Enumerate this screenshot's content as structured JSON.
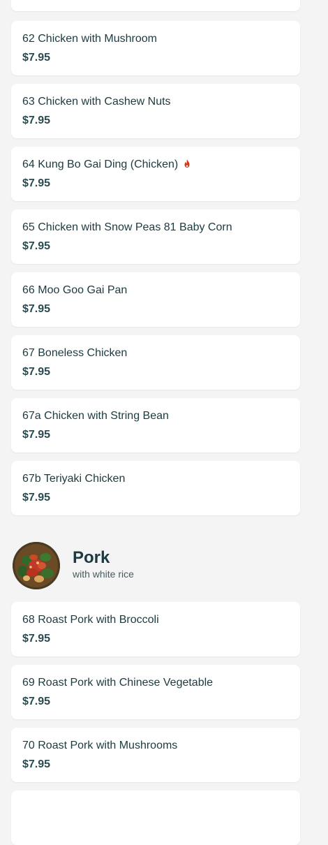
{
  "items_above": [
    {
      "name": "62 Chicken with Mushroom",
      "price": "$7.95",
      "spicy": false
    },
    {
      "name": "63 Chicken with Cashew Nuts",
      "price": "$7.95",
      "spicy": false
    },
    {
      "name": "64 Kung Bo Gai Ding (Chicken)",
      "price": "$7.95",
      "spicy": true
    },
    {
      "name": "65 Chicken with Snow Peas 81 Baby Corn",
      "price": "$7.95",
      "spicy": false
    },
    {
      "name": "66 Moo Goo Gai Pan",
      "price": "$7.95",
      "spicy": false
    },
    {
      "name": "67 Boneless Chicken",
      "price": "$7.95",
      "spicy": false
    },
    {
      "name": "67a Chicken with String Bean",
      "price": "$7.95",
      "spicy": false
    },
    {
      "name": "67b Teriyaki Chicken",
      "price": "$7.95",
      "spicy": false
    }
  ],
  "section": {
    "title": "Pork",
    "subtitle": "with white rice",
    "thumb_icon": "pork-dish-photo"
  },
  "items_below": [
    {
      "name": "68 Roast Pork with Broccoli",
      "price": "$7.95",
      "spicy": false
    },
    {
      "name": "69 Roast Pork with Chinese Vegetable",
      "price": "$7.95",
      "spicy": false
    },
    {
      "name": "70 Roast Pork with Mushrooms",
      "price": "$7.95",
      "spicy": false
    }
  ],
  "colors": {
    "background": "#f4f4f4",
    "card": "#ffffff",
    "text": "#1c3a40",
    "spicy": "#d0391b"
  }
}
